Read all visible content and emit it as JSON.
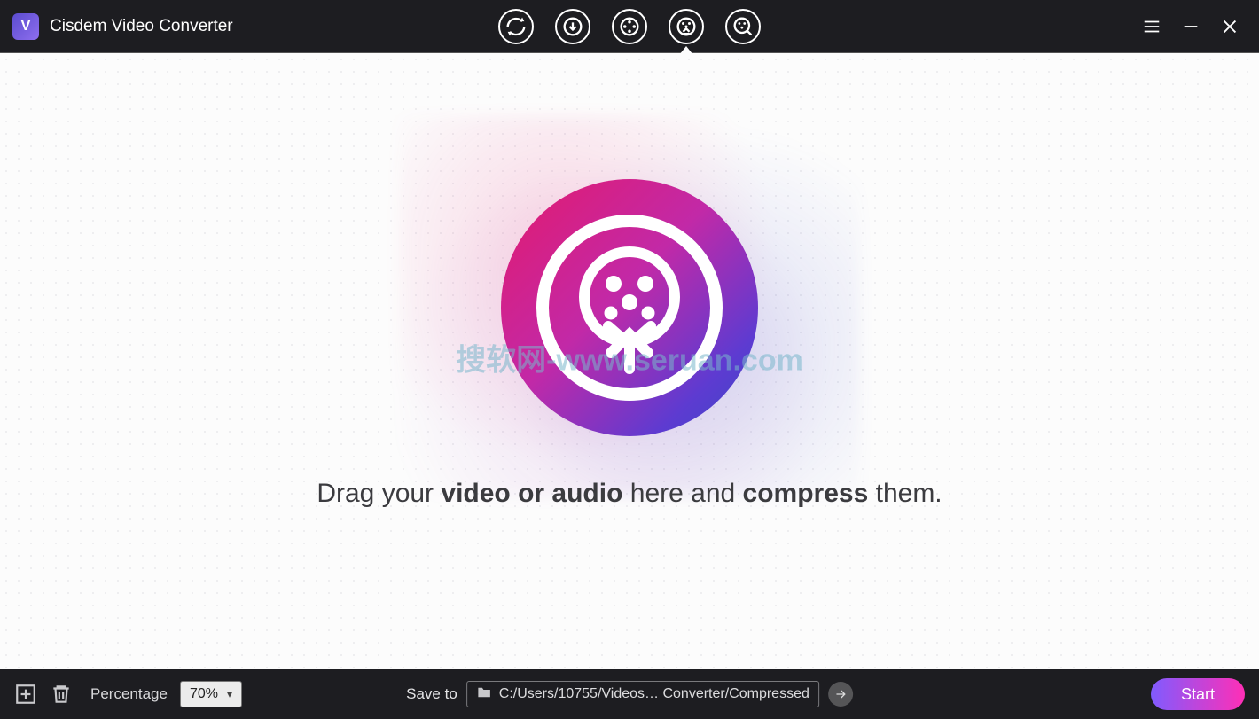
{
  "app": {
    "title": "Cisdem Video Converter"
  },
  "modes": {
    "convert": "convert-mode",
    "download": "download-mode",
    "rip": "rip-mode",
    "compress": "compress-mode",
    "enhance": "enhance-mode",
    "active": "compress"
  },
  "hero": {
    "prefix": "Drag your ",
    "bold1": "video or audio",
    "mid": " here and ",
    "bold2": "compress",
    "suffix": " them."
  },
  "watermark": "搜软网-www.seruan.com",
  "bottom": {
    "percentage_label": "Percentage",
    "percentage_value": "70%",
    "save_to_label": "Save to",
    "save_path": "C:/Users/10755/Videos… Converter/Compressed",
    "start_label": "Start"
  }
}
